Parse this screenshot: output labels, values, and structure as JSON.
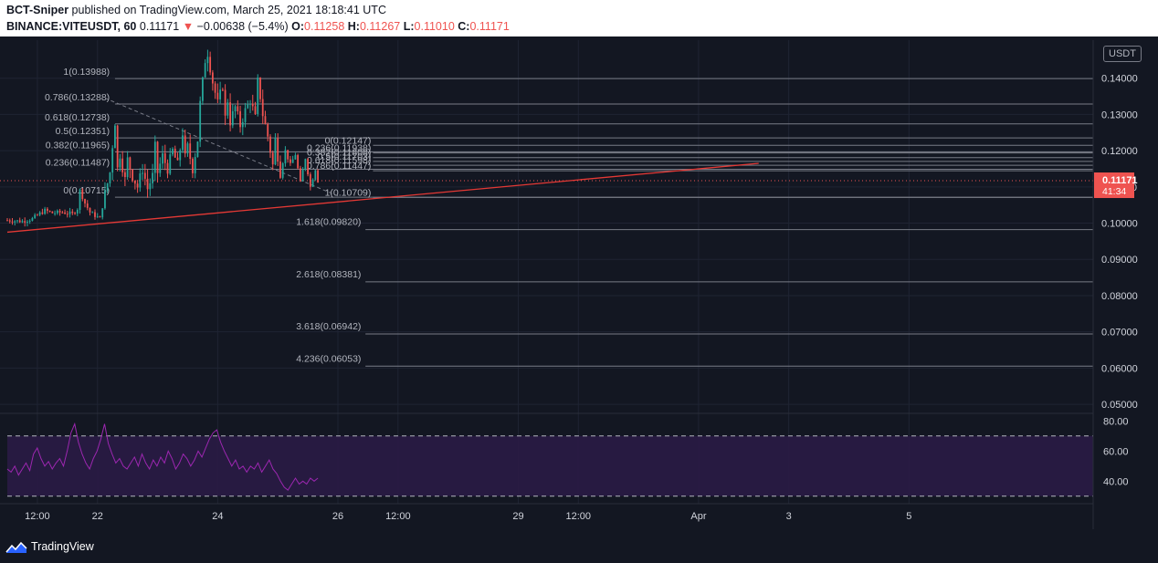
{
  "header": {
    "author": "BCT-Sniper",
    "published_text": "published on TradingView.com, March 25, 2021 18:18:41 UTC",
    "symbol": "BINANCE:VITEUSDT, 60",
    "last": "0.11171",
    "change": "−0.00638 (−5.4%)",
    "open_label": "O:",
    "open": "0.11258",
    "high_label": "H:",
    "high": "0.11267",
    "low_label": "L:",
    "low": "0.11010",
    "close_label": "C:",
    "close": "0.11171"
  },
  "colors": {
    "background": "#131722",
    "up_candle": "#26a69a",
    "down_candle": "#ef5350",
    "trendline": "#e53935",
    "rsi_line": "#9c27b0",
    "rsi_band": "#2a1b45",
    "fib_line": "#787b86",
    "price_label_bg": "#ef5350"
  },
  "chart_data": {
    "type": "candlestick",
    "y_axis": {
      "unit_label": "USDT",
      "ticks": [
        "0.14000",
        "0.13000",
        "0.12000",
        "0.11000",
        "0.10000",
        "0.09000",
        "0.08000",
        "0.07000",
        "0.06000",
        "0.05000"
      ],
      "tick_values": [
        0.14,
        0.13,
        0.12,
        0.11,
        0.1,
        0.09,
        0.08,
        0.07,
        0.06,
        0.05
      ],
      "range": [
        0.0475,
        0.1505
      ]
    },
    "x_axis": {
      "ticks": [
        "12:00",
        "22",
        "24",
        "26",
        "12:00",
        "29",
        "12:00",
        "Apr",
        "3",
        "5"
      ],
      "tick_values": [
        12,
        36,
        84,
        132,
        156,
        204,
        228,
        276,
        312,
        360
      ]
    },
    "last_price": {
      "value": 0.11171,
      "label": "0.11171",
      "countdown": "41:34"
    },
    "price_path": [
      [
        0,
        0.1008
      ],
      [
        6,
        0.1005
      ],
      [
        10,
        0.1012
      ],
      [
        12,
        0.1022
      ],
      [
        15,
        0.1035
      ],
      [
        18,
        0.1028
      ],
      [
        22,
        0.103
      ],
      [
        26,
        0.1025
      ],
      [
        28,
        0.104
      ],
      [
        29,
        0.109
      ],
      [
        31,
        0.1055
      ],
      [
        33,
        0.103
      ],
      [
        37,
        0.1012
      ],
      [
        39,
        0.108
      ],
      [
        41,
        0.114
      ],
      [
        42,
        0.1215
      ],
      [
        43,
        0.128
      ],
      [
        44,
        0.115
      ],
      [
        45,
        0.119
      ],
      [
        47,
        0.112
      ],
      [
        48,
        0.1175
      ],
      [
        50,
        0.113
      ],
      [
        52,
        0.11
      ],
      [
        54,
        0.115
      ],
      [
        56,
        0.1095
      ],
      [
        58,
        0.113
      ],
      [
        59,
        0.121
      ],
      [
        60,
        0.114
      ],
      [
        62,
        0.1185
      ],
      [
        64,
        0.115
      ],
      [
        66,
        0.12
      ],
      [
        68,
        0.116
      ],
      [
        70,
        0.125
      ],
      [
        71,
        0.118
      ],
      [
        72,
        0.121
      ],
      [
        74,
        0.115
      ],
      [
        76,
        0.123
      ],
      [
        77,
        0.133
      ],
      [
        78,
        0.139
      ],
      [
        79,
        0.145
      ],
      [
        80,
        0.147
      ],
      [
        81,
        0.143
      ],
      [
        82,
        0.139
      ],
      [
        84,
        0.133
      ],
      [
        86,
        0.138
      ],
      [
        87,
        0.129
      ],
      [
        88,
        0.134
      ],
      [
        89,
        0.128
      ],
      [
        91,
        0.132
      ],
      [
        93,
        0.127
      ],
      [
        95,
        0.131
      ],
      [
        97,
        0.134
      ],
      [
        99,
        0.129
      ],
      [
        100,
        0.139
      ],
      [
        101,
        0.135
      ],
      [
        102,
        0.13
      ],
      [
        104,
        0.124
      ],
      [
        106,
        0.116
      ],
      [
        107,
        0.123
      ],
      [
        109,
        0.114
      ],
      [
        111,
        0.12
      ],
      [
        113,
        0.116
      ],
      [
        115,
        0.119
      ],
      [
        117,
        0.111
      ],
      [
        119,
        0.118
      ],
      [
        121,
        0.11
      ],
      [
        123,
        0.115
      ],
      [
        124,
        0.1117
      ]
    ],
    "fib_retracement_1": {
      "levels": [
        {
          "label": "1(0.13988)",
          "value": 0.13988
        },
        {
          "label": "0.786(0.13288)",
          "value": 0.13288
        },
        {
          "label": "0.618(0.12738)",
          "value": 0.12738
        },
        {
          "label": "0.5(0.12351)",
          "value": 0.12351
        },
        {
          "label": "0.382(0.11965)",
          "value": 0.11965
        },
        {
          "label": "0.236(0.11487)",
          "value": 0.11487
        },
        {
          "label": "0(0.10715)",
          "value": 0.10715
        }
      ]
    },
    "fib_retracement_2": {
      "levels": [
        {
          "label": "0(0.12147)",
          "value": 0.12147
        },
        {
          "label": "0.236(0.11938)",
          "value": 0.11938
        },
        {
          "label": "0.382(0.11808)",
          "value": 0.11808
        },
        {
          "label": "0.5(0.11703)",
          "value": 0.11703
        },
        {
          "label": "0.618(0.11598)",
          "value": 0.11598
        },
        {
          "label": "0.786(0.11447)",
          "value": 0.11447
        },
        {
          "label": "1(0.10709)",
          "value": 0.10709
        }
      ]
    },
    "fib_extensions": [
      {
        "label": "1.618(0.09820)",
        "value": 0.0982
      },
      {
        "label": "2.618(0.08381)",
        "value": 0.08381
      },
      {
        "label": "3.618(0.06942)",
        "value": 0.06942
      },
      {
        "label": "4.236(0.06053)",
        "value": 0.06053
      }
    ],
    "trendline": {
      "from": [
        0,
        0.0975
      ],
      "to": [
        300,
        0.1165
      ]
    },
    "diagonal": {
      "from": [
        39,
        0.1345
      ],
      "to": [
        132,
        0.1075
      ]
    },
    "rsi": {
      "ticks": [
        "80.00",
        "60.00",
        "40.00"
      ],
      "tick_values": [
        80,
        60,
        40
      ],
      "band": [
        70,
        30
      ],
      "range": [
        25,
        85
      ],
      "values": [
        48,
        46,
        50,
        44,
        48,
        52,
        47,
        58,
        62,
        55,
        50,
        53,
        48,
        52,
        55,
        50,
        60,
        72,
        78,
        66,
        58,
        52,
        48,
        55,
        60,
        68,
        78,
        65,
        58,
        52,
        55,
        50,
        48,
        52,
        56,
        50,
        58,
        52,
        48,
        54,
        50,
        56,
        52,
        60,
        55,
        48,
        52,
        58,
        55,
        50,
        54,
        60,
        56,
        62,
        68,
        72,
        74,
        66,
        60,
        55,
        50,
        54,
        48,
        50,
        46,
        50,
        48,
        52,
        46,
        50,
        54,
        48,
        45,
        40,
        36,
        34,
        38,
        42,
        38,
        40,
        38,
        42,
        40,
        42
      ]
    }
  },
  "footer": {
    "brand": "TradingView"
  }
}
